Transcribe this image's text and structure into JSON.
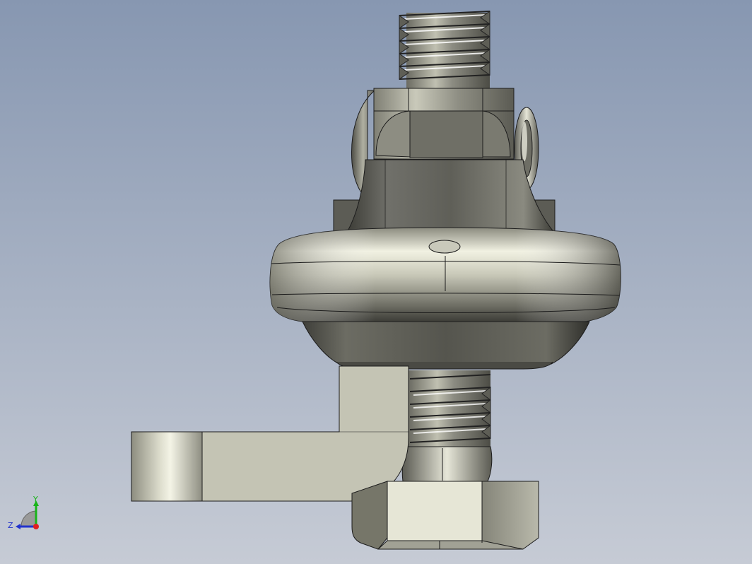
{
  "viewport": {
    "background_top": "#8a9bb4",
    "background_bottom": "#c3c9d4",
    "part_color_light": "#e8e8da",
    "part_color_mid": "#a9a99c",
    "part_color_dark": "#4e4e48",
    "edge_color": "#1c1c1c"
  },
  "triad": {
    "y_label": "Y",
    "z_label": "Z",
    "y_color": "#19b419",
    "z_color": "#2233cc",
    "x_color": "#e02020"
  }
}
